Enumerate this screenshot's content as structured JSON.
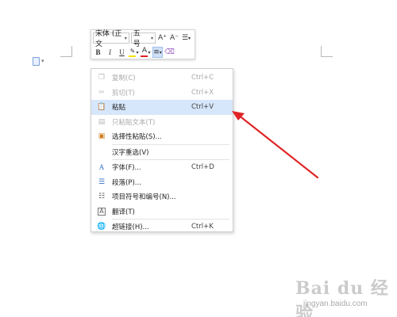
{
  "toolbar": {
    "font_name": "宋体 (正文",
    "font_size": "五号",
    "grow_font": "A⁺",
    "shrink_font": "A⁻",
    "bold": "B",
    "italic": "I",
    "underline": "U",
    "font_color": "A",
    "highlight_color": "#f5e100",
    "font_color_value": "#e02020"
  },
  "context_menu": {
    "items": [
      {
        "label": "复制(C)",
        "shortcut": "Ctrl+C",
        "icon": "copy-icon",
        "disabled": true
      },
      {
        "label": "剪切(T)",
        "shortcut": "Ctrl+X",
        "icon": "cut-icon",
        "disabled": true
      },
      {
        "label": "粘贴",
        "shortcut": "Ctrl+V",
        "icon": "paste-icon",
        "disabled": false,
        "hover": true
      },
      {
        "label": "只粘贴文本(T)",
        "shortcut": "",
        "icon": "paste-text-icon",
        "disabled": true
      },
      {
        "label": "选择性粘贴(S)...",
        "shortcut": "",
        "icon": "paste-special-icon",
        "disabled": false
      },
      {
        "label": "汉字重选(V)",
        "shortcut": "",
        "icon": "",
        "disabled": false
      },
      {
        "label": "字体(F)...",
        "shortcut": "Ctrl+D",
        "icon": "font-icon",
        "disabled": false
      },
      {
        "label": "段落(P)...",
        "shortcut": "",
        "icon": "paragraph-icon",
        "disabled": false
      },
      {
        "label": "项目符号和编号(N)...",
        "shortcut": "",
        "icon": "bullets-icon",
        "disabled": false
      },
      {
        "label": "翻译(T)",
        "shortcut": "",
        "icon": "translate-icon",
        "disabled": false
      },
      {
        "label": "超链接(H)...",
        "shortcut": "Ctrl+K",
        "icon": "hyperlink-icon",
        "disabled": false
      }
    ]
  },
  "annotation": {
    "arrow_color": "#e02424"
  },
  "watermark": {
    "main": "Bai du 经验",
    "sub": "jingyan.baidu.com"
  }
}
